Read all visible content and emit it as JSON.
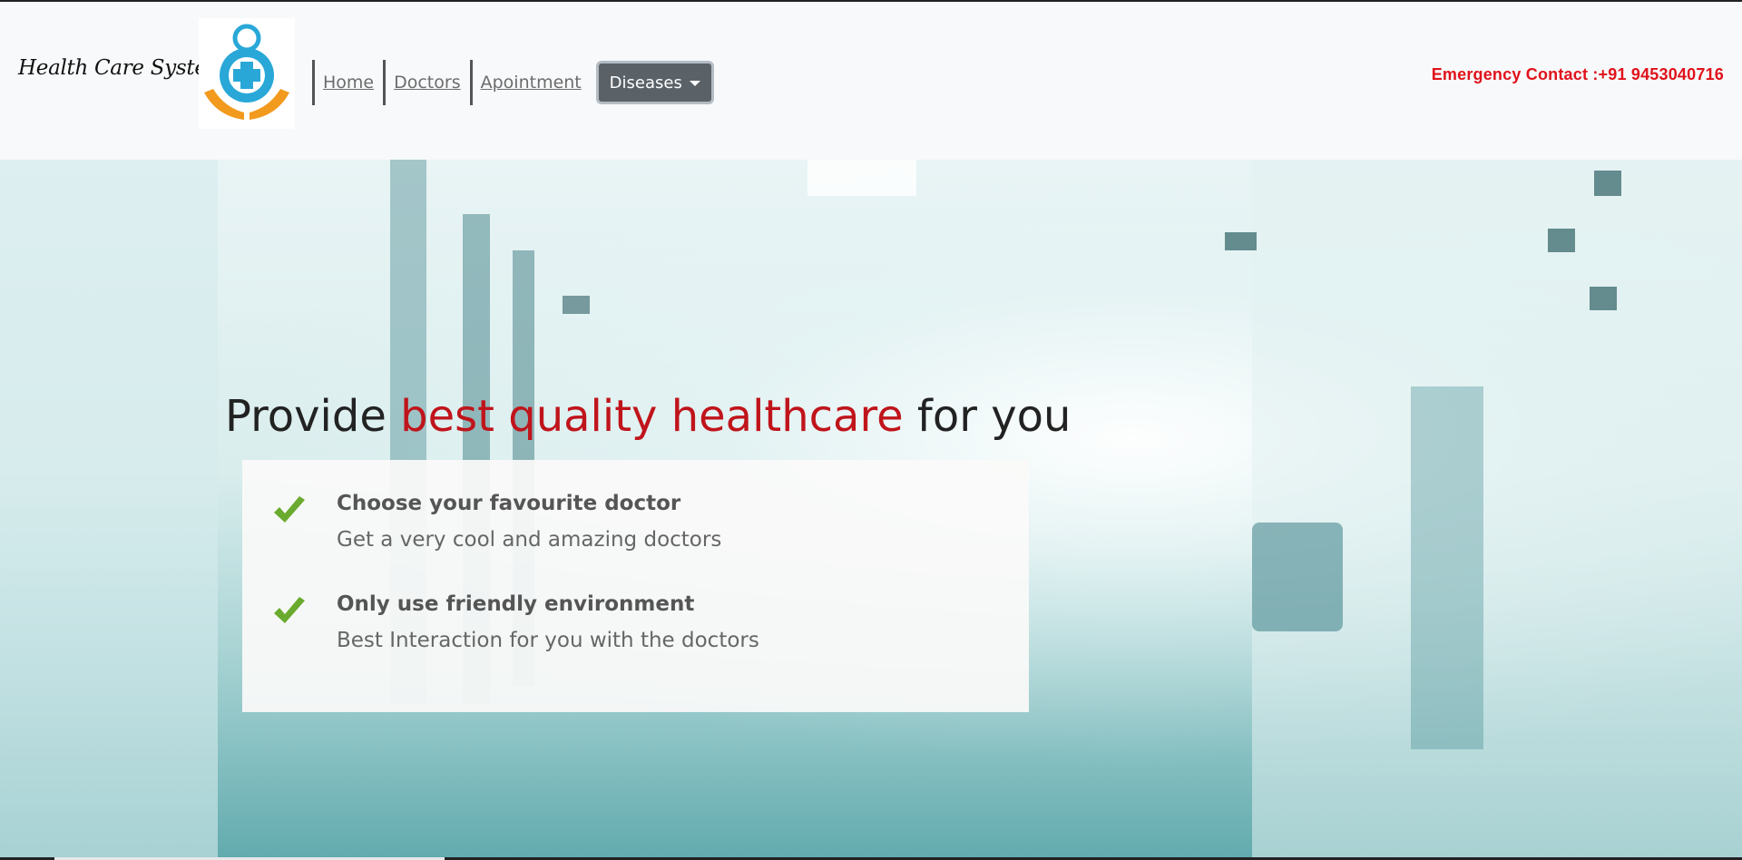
{
  "header": {
    "brand": "Health Care System",
    "nav": {
      "home": "Home",
      "doctors": "Doctors",
      "appointment": "Apointment",
      "diseases": "Diseases"
    },
    "emergency": "Emergency Contact :+91 9453040716"
  },
  "hero": {
    "title_prefix": "Provide ",
    "title_accent": "best quality healthcare",
    "title_suffix": " for you",
    "features": [
      {
        "title": "Choose your favourite doctor",
        "desc": "Get a very cool and amazing doctors"
      },
      {
        "title": "Only use friendly environment",
        "desc": "Best Interaction for you with the doctors"
      }
    ]
  },
  "colors": {
    "accent": "#c0141b",
    "emergency": "#e0121b",
    "check": "#6aaa2e",
    "dropdown_bg": "#5a6268",
    "logo_blue": "#29a8d8",
    "logo_orange": "#f29a1d"
  },
  "icons": {
    "logo": "health-care-logo",
    "check": "check-icon",
    "dropdown": "caret-down-icon"
  }
}
